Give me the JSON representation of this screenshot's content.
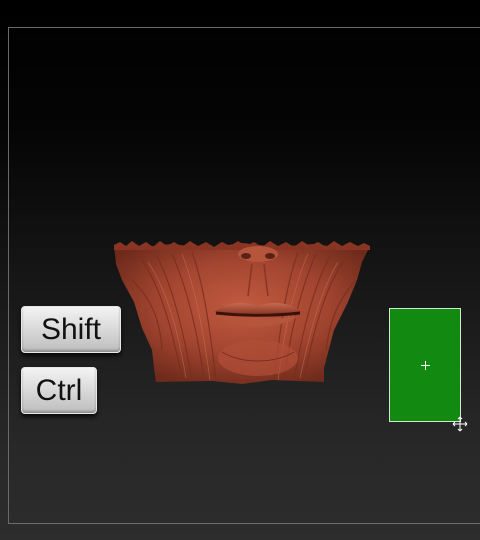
{
  "viewport": {
    "background_top": "#000000",
    "background_bottom": "#2d2d2d",
    "frame_color": "#6a6a6a"
  },
  "model": {
    "icon": "sculpted-lower-face-model",
    "base_color": "#a64a33",
    "highlight_color": "#c8694f",
    "shadow_color": "#5a2216"
  },
  "keys": {
    "shift_label": "Shift",
    "ctrl_label": "Ctrl"
  },
  "swatch": {
    "color": "#128a12",
    "icon": "crosshair-icon"
  },
  "cursor": {
    "icon": "move-cursor-icon"
  }
}
